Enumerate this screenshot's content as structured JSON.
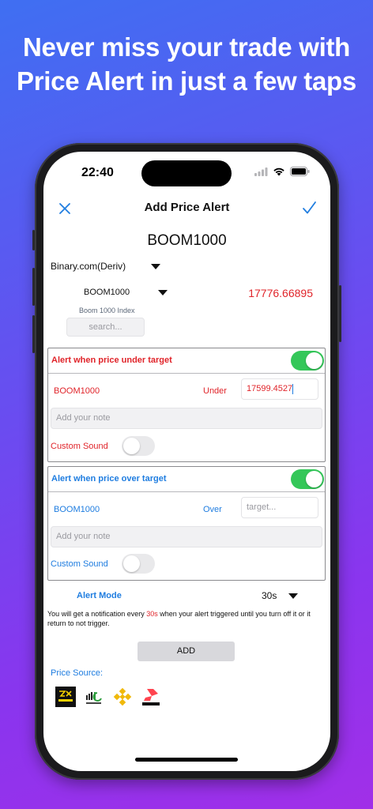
{
  "headline": {
    "line1": "Never miss your trade with",
    "line2": "Price Alert in just a few taps"
  },
  "statusbar": {
    "time": "22:40"
  },
  "nav": {
    "title": "Add Price Alert"
  },
  "symbol_title": "BOOM1000",
  "broker": {
    "selected": "Binary.com(Deriv)"
  },
  "symbol_select": {
    "selected": "BOOM1000",
    "description": "Boom 1000 Index",
    "price": "17776.66895"
  },
  "search": {
    "placeholder": "search..."
  },
  "alert_under": {
    "label": "Alert when price under target",
    "symbol": "BOOM1000",
    "condition": "Under",
    "target_value": "17599.4527",
    "note_placeholder": "Add your note",
    "custom_sound_label": "Custom Sound",
    "enabled": true,
    "custom_sound": false
  },
  "alert_over": {
    "label": "Alert when price over target",
    "symbol": "BOOM1000",
    "condition": "Over",
    "target_placeholder": "target...",
    "note_placeholder": "Add your note",
    "custom_sound_label": "Custom Sound",
    "enabled": true,
    "custom_sound": false
  },
  "alert_mode": {
    "label": "Alert Mode",
    "value": "30s",
    "note_prefix": "You will get a notification every ",
    "note_highlight": "30s",
    "note_suffix": " when your alert triggered until you turn off it or it return to not trigger."
  },
  "add_button": {
    "label": "ADD"
  },
  "price_source": {
    "label": "Price Source:",
    "logos": [
      "exness",
      "IC Markets",
      "Binance",
      "DERIV"
    ]
  },
  "colors": {
    "accent_blue": "#1f7de0",
    "alert_red": "#e0242a",
    "toggle_on": "#34c759"
  }
}
